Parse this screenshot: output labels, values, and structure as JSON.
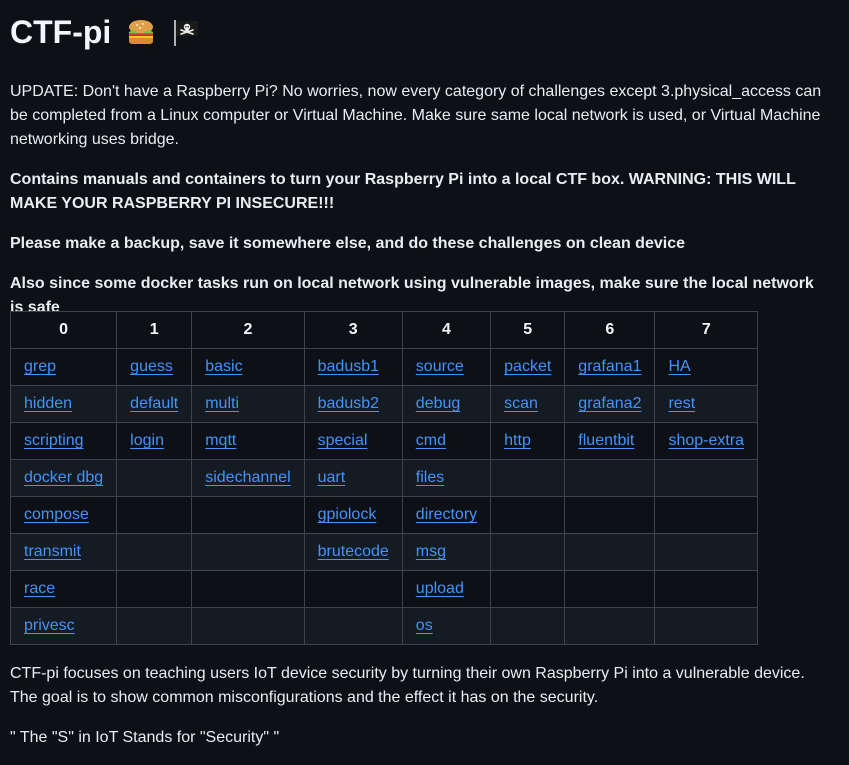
{
  "page": {
    "title": "CTF-pi",
    "title_emojis": [
      "sandwich-icon",
      "pirate-flag-icon"
    ]
  },
  "paragraphs": {
    "update": "UPDATE: Don't have a Raspberry Pi? No worries, now every category of challenges except 3.physical_access can be completed from a Linux computer or Virtual Machine. Make sure same local network is used, or Virtual Machine networking uses bridge.",
    "contains": "Contains manuals and containers to turn your Raspberry Pi into a local CTF box. WARNING: THIS WILL MAKE YOUR RASPBERRY PI INSECURE!!!",
    "backup": "Please make a backup, save it somewhere else, and do these challenges on clean device",
    "docker": "Also since some docker tasks run on local network using vulnerable images, make sure the local network is safe",
    "focus": "CTF-pi focuses on teaching users IoT device security by turning their own Raspberry Pi into a vulnerable device. The goal is to show common misconfigurations and the effect it has on the security.",
    "quote": "\" The \"S\" in IoT Stands for \"Security\" \""
  },
  "table": {
    "headers": [
      "0",
      "1",
      "2",
      "3",
      "4",
      "5",
      "6",
      "7"
    ],
    "rows": [
      [
        "grep",
        "guess",
        "basic",
        "badusb1",
        "source",
        "packet",
        "grafana1",
        "HA"
      ],
      [
        "hidden",
        "default",
        "multi",
        "badusb2",
        "debug",
        "scan",
        "grafana2",
        "rest"
      ],
      [
        "scripting",
        "login",
        "mqtt",
        "special",
        "cmd",
        "http",
        "fluentbit",
        "shop-extra"
      ],
      [
        "docker dbg",
        "",
        "sidechannel",
        "uart",
        "files",
        "",
        "",
        ""
      ],
      [
        "compose",
        "",
        "",
        "gpiolock",
        "directory",
        "",
        "",
        ""
      ],
      [
        "transmit",
        "",
        "",
        "brutecode",
        "msg",
        "",
        "",
        ""
      ],
      [
        "race",
        "",
        "",
        "",
        "upload",
        "",
        "",
        ""
      ],
      [
        "privesc",
        "",
        "",
        "",
        "os",
        "",
        "",
        ""
      ]
    ]
  },
  "colors": {
    "background": "#0d1117",
    "text": "#e6edf3",
    "link": "#4493f8",
    "border": "#3d444d",
    "row_alt": "#151b23"
  }
}
